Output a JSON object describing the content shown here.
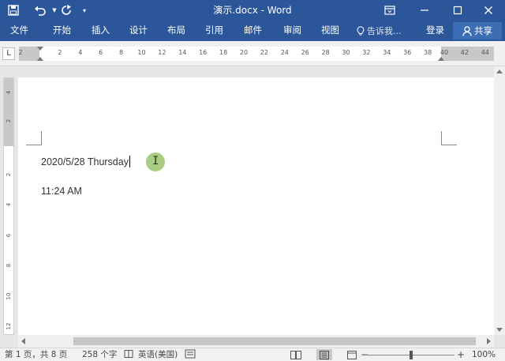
{
  "window": {
    "title": "演示.docx - Word"
  },
  "quick_access": {
    "save_icon": "save-icon",
    "undo_icon": "undo-icon",
    "redo_icon": "redo-icon",
    "customize_icon": "chevron-down-icon"
  },
  "ribbon": {
    "tabs": [
      "文件",
      "开始",
      "插入",
      "设计",
      "布局",
      "引用",
      "邮件",
      "审阅",
      "视图"
    ],
    "tell_me": "告诉我...",
    "login": "登录",
    "share": "共享"
  },
  "ruler": {
    "tab_selector": "L",
    "left_numbers": [
      "2"
    ],
    "numbers": [
      "2",
      "4",
      "6",
      "8",
      "10",
      "12",
      "14",
      "16",
      "18",
      "20",
      "22",
      "24",
      "26",
      "28",
      "30",
      "32",
      "34",
      "36",
      "38"
    ],
    "right_numbers": [
      "40",
      "42",
      "44"
    ],
    "vertical_numbers": [
      "4",
      "2",
      "2",
      "4",
      "6",
      "8",
      "10",
      "12"
    ]
  },
  "document": {
    "line1": "2020/5/28 Thursday",
    "line2": "11:24 AM"
  },
  "status": {
    "page": "第 1 页，共 8 页",
    "words": "258 个字",
    "language": "英语(美国)",
    "zoom": "100%",
    "zoom_level": 1.0,
    "minus": "−",
    "plus": "+"
  },
  "colors": {
    "brand": "#2b579a",
    "cursor_highlight": "#8cbe5a"
  }
}
